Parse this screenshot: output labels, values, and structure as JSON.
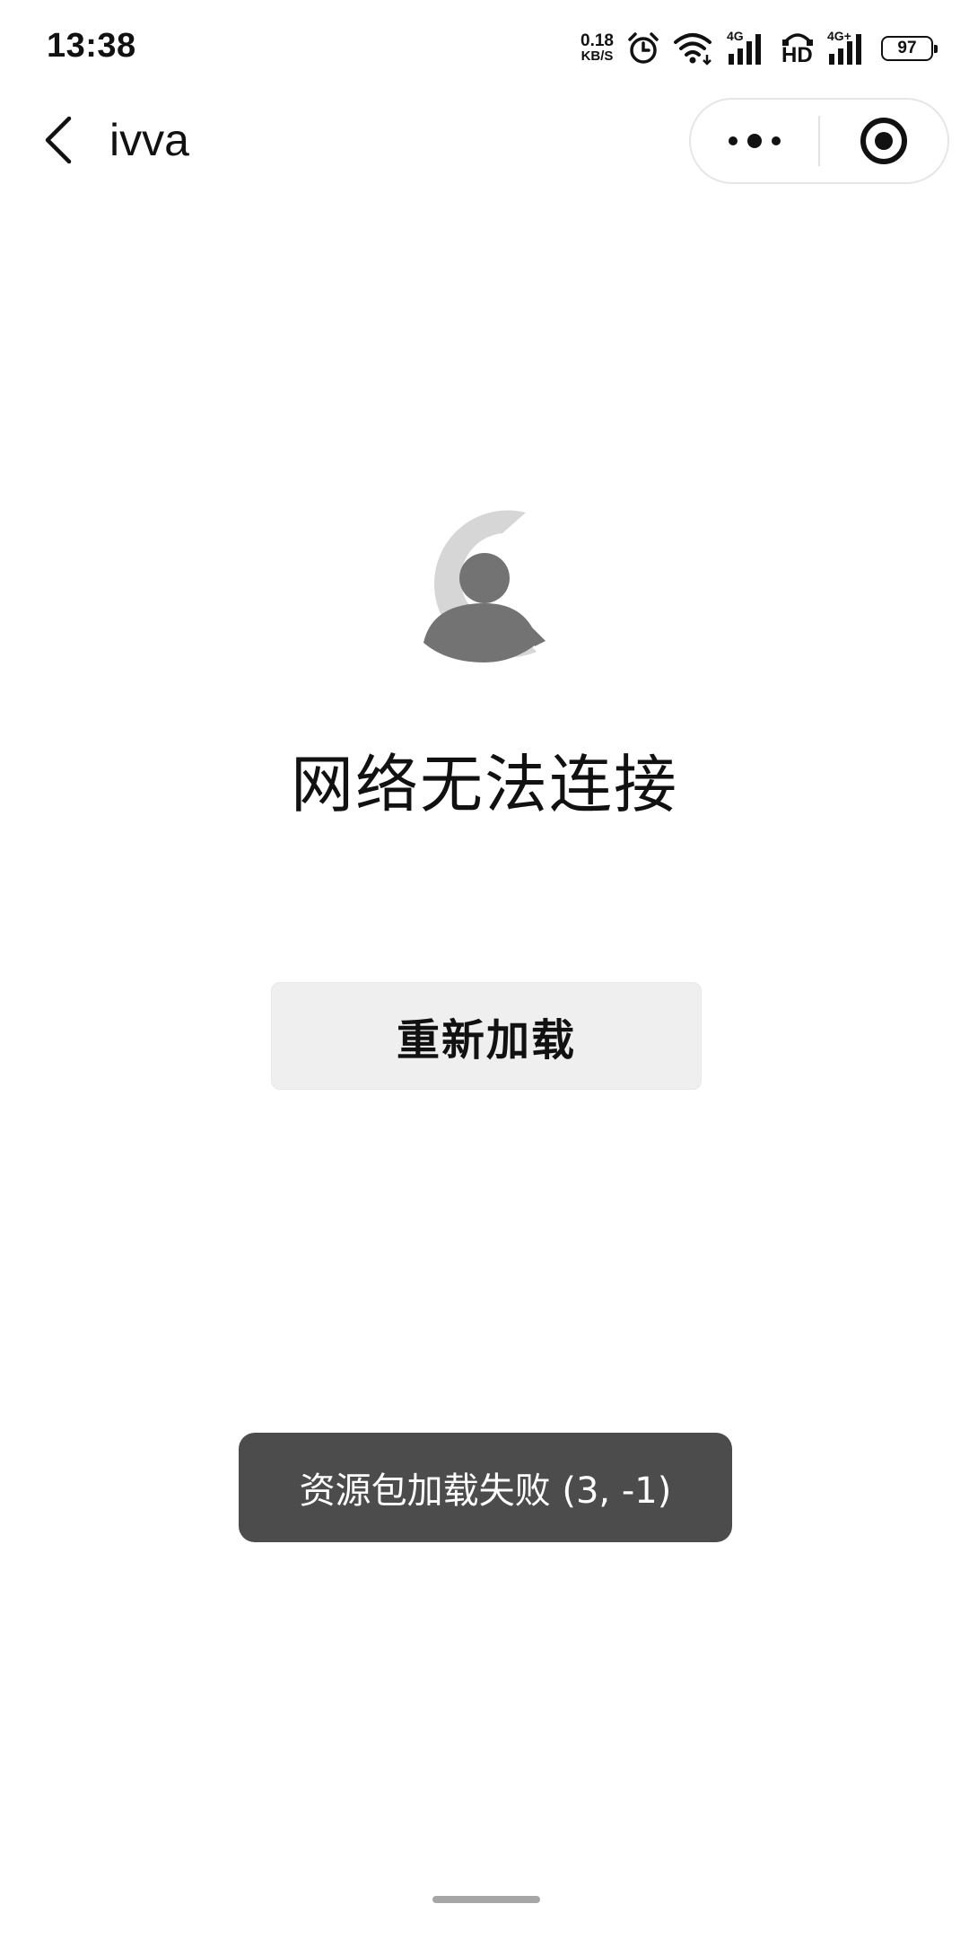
{
  "status_bar": {
    "time": "13:38",
    "net_speed_value": "0.18",
    "net_speed_unit": "KB/S",
    "signal_1_label": "4G",
    "hd_label": "HD",
    "signal_2_label": "4G+",
    "battery": "97",
    "icons": [
      "alarm-icon",
      "wifi-icon",
      "signal-icon",
      "hd-voice-icon",
      "signal-icon",
      "battery-icon"
    ]
  },
  "nav": {
    "title": "ivva",
    "icons": [
      "back-chevron-icon",
      "more-dots-icon",
      "close-target-icon"
    ]
  },
  "main": {
    "error_title": "网络无法连接",
    "reload_label": "重新加载",
    "logo_icon": "app-user-logo-icon"
  },
  "toast": {
    "message": "资源包加载失败 (3, -1)"
  },
  "colors": {
    "background": "#ffffff",
    "text": "#111111",
    "button_bg": "#efefef",
    "toast_bg": "#4c4c4c",
    "logo_light": "#d6d6d6",
    "logo_dark": "#737373"
  }
}
